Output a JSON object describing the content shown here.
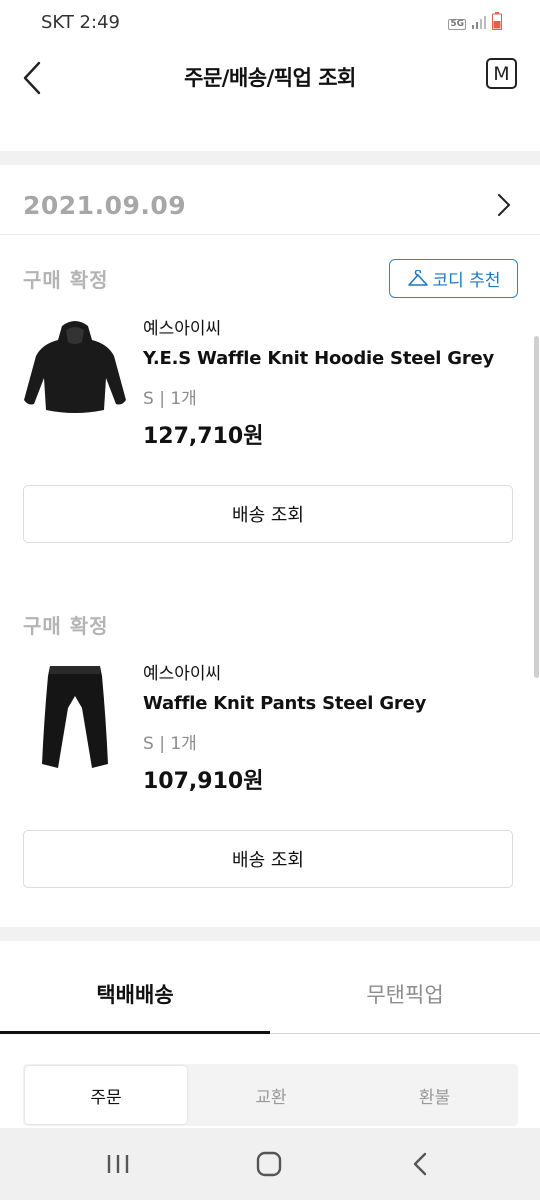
{
  "status_bar": {
    "carrier_time": "SKT  2:49",
    "network": "5G"
  },
  "header": {
    "title": "주문/배송/픽업 조회",
    "menu_label": "M"
  },
  "order": {
    "date": "2021.09.09",
    "items": [
      {
        "status": "구매 확정",
        "brand": "예스아이씨",
        "name": "Y.E.S Waffle Knit Hoodie Steel Grey",
        "options": "S  |  1개",
        "price": "127,710원",
        "ship_button": "배송 조회"
      },
      {
        "status": "구매 확정",
        "brand": "예스아이씨",
        "name": "Waffle Knit Pants Steel Grey",
        "options": "S  |  1개",
        "price": "107,910원",
        "ship_button": "배송 조회"
      }
    ],
    "codi_button": "코디 추천"
  },
  "tabs": [
    {
      "label": "택배배송",
      "active": true
    },
    {
      "label": "무탠픽업",
      "active": false
    }
  ],
  "segments": [
    {
      "label": "주문",
      "active": true
    },
    {
      "label": "교환",
      "active": false
    },
    {
      "label": "환불",
      "active": false
    }
  ],
  "colors": {
    "accent_blue": "#1f7ac0",
    "date_grey": "#a7a7a7"
  },
  "icons": [
    "back-arrow-icon",
    "menu-m-icon",
    "chevron-right-icon",
    "hanger-icon",
    "nav-recents-icon",
    "nav-home-icon",
    "nav-back-icon"
  ]
}
